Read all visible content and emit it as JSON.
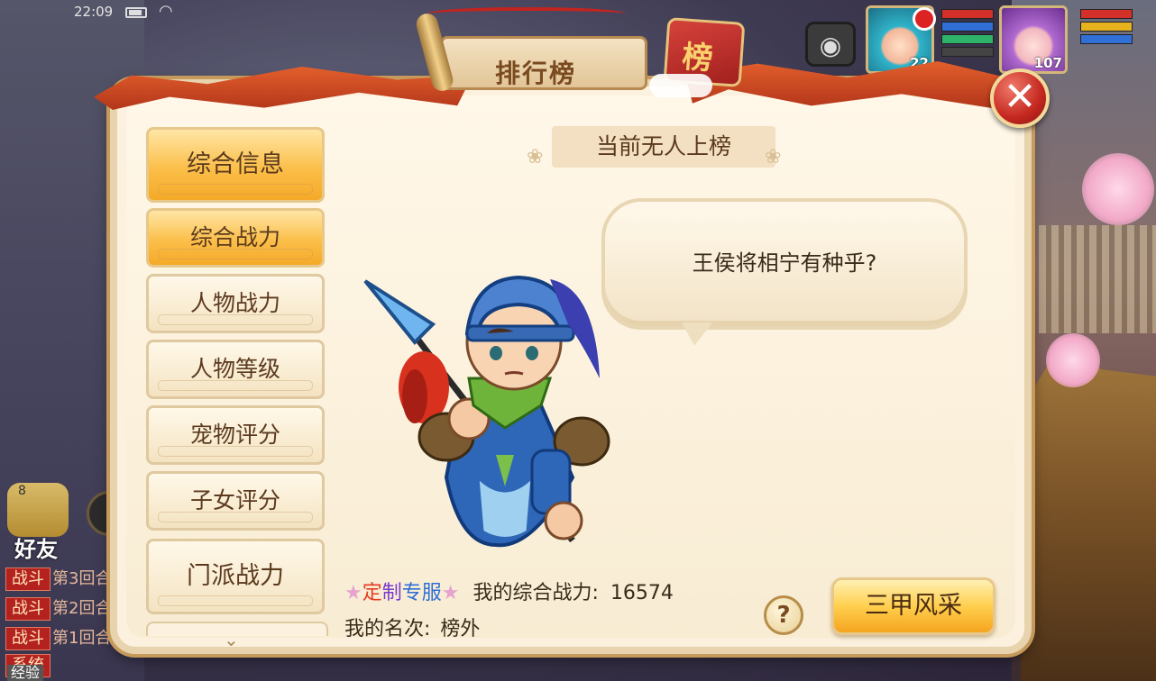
{
  "status_bar": {
    "time": "22:09"
  },
  "hud": {
    "player1_level": "22",
    "player2_level": "107"
  },
  "chat": {
    "friends_badge": "8",
    "friends_label": "好友",
    "lines": [
      {
        "tag": "战斗",
        "text": "第3回合"
      },
      {
        "tag": "战斗",
        "text": "第2回合"
      },
      {
        "tag": "战斗",
        "text": "第1回合"
      },
      {
        "tag": "系统",
        "text": ""
      }
    ],
    "exp_label": "经验"
  },
  "panel": {
    "title": "排行榜",
    "badge": "榜",
    "close_icon": "close-x",
    "tabs": [
      {
        "label": "综合信息",
        "active": true
      },
      {
        "label": "综合战力",
        "active": true
      },
      {
        "label": "人物战力",
        "active": false
      },
      {
        "label": "人物等级",
        "active": false
      },
      {
        "label": "宠物评分",
        "active": false
      },
      {
        "label": "子女评分",
        "active": false
      },
      {
        "label": "门派战力",
        "active": false
      }
    ],
    "scroll_indicator": "⌄",
    "rank_header": "当前无人上榜",
    "bubble_text": "王侯将相宁有种乎?",
    "custom_server": {
      "star": "★",
      "c1": "定",
      "c2": "制",
      "c3": "专服"
    },
    "my_power_label": "我的综合战力:",
    "my_power_value": "16574",
    "my_rank_label": "我的名次:",
    "my_rank_value": "榜外",
    "help_label": "?",
    "sanjia_button": "三甲风采"
  },
  "colors": {
    "accent_gold": "#f5a928",
    "panel_bg": "#fbf1de",
    "close_red": "#c4271f",
    "ribbon": "#d14c25"
  }
}
